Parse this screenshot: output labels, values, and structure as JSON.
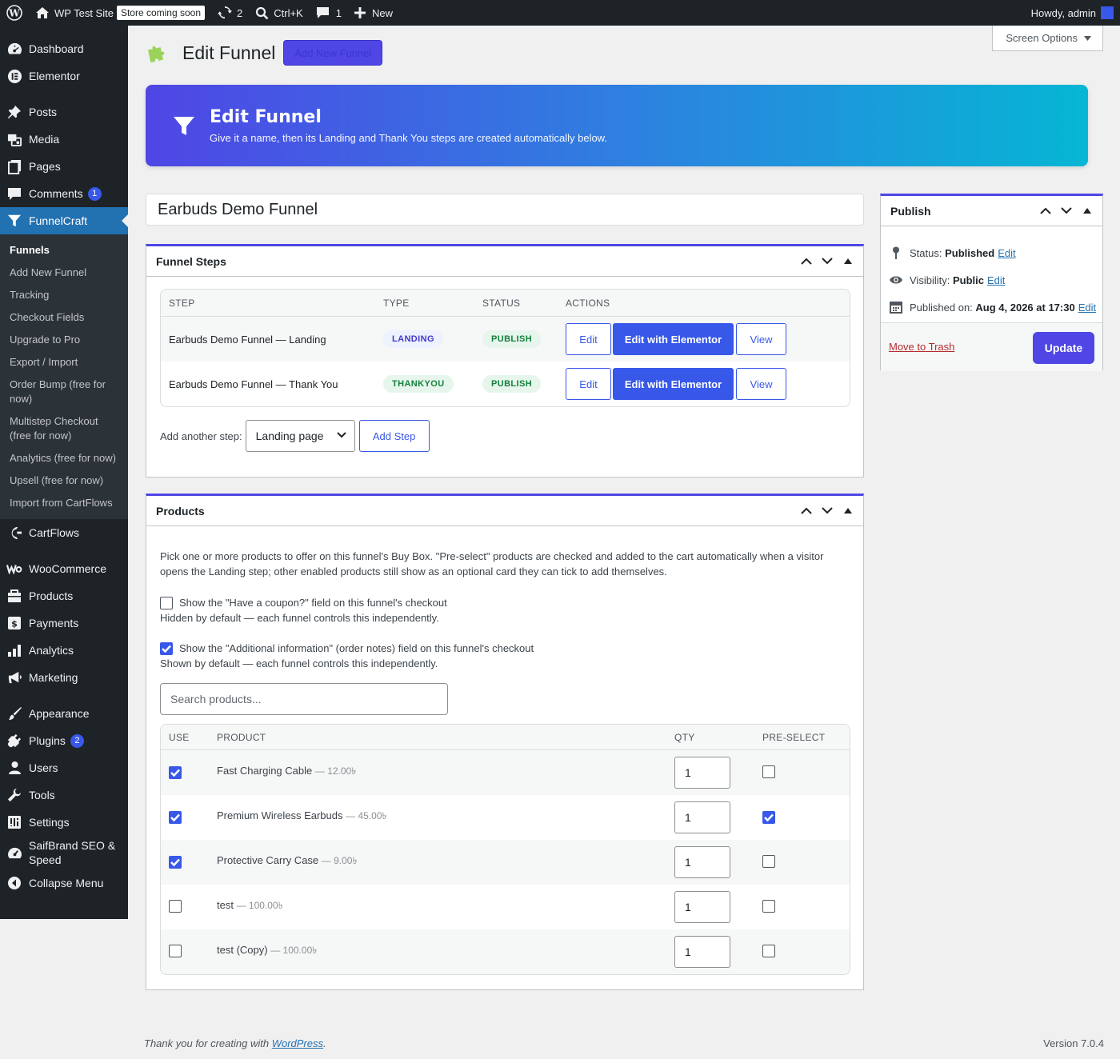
{
  "adminbar": {
    "site_name": "WP Test Site",
    "store_badge": "Store coming soon",
    "updates_count": "2",
    "search_shortcut": "Ctrl+K",
    "comments_count": "1",
    "new_label": "New",
    "howdy": "Howdy, admin"
  },
  "sidebar": {
    "items": [
      {
        "label": "Dashboard",
        "icon": "dashboard-icon"
      },
      {
        "label": "Elementor",
        "icon": "elementor-icon"
      },
      {
        "label": "Posts",
        "icon": "pin-icon"
      },
      {
        "label": "Media",
        "icon": "media-icon"
      },
      {
        "label": "Pages",
        "icon": "pages-icon"
      },
      {
        "label": "Comments",
        "icon": "comment-icon",
        "badge": "1"
      },
      {
        "label": "FunnelCraft",
        "icon": "funnel-icon"
      },
      {
        "label": "CartFlows",
        "icon": "cartflows-icon"
      },
      {
        "label": "WooCommerce",
        "icon": "woo-icon"
      },
      {
        "label": "Products",
        "icon": "products-icon"
      },
      {
        "label": "Payments",
        "icon": "payments-icon"
      },
      {
        "label": "Analytics",
        "icon": "analytics-icon"
      },
      {
        "label": "Marketing",
        "icon": "megaphone-icon"
      },
      {
        "label": "Appearance",
        "icon": "brush-icon"
      },
      {
        "label": "Plugins",
        "icon": "plugin-icon",
        "badge": "2"
      },
      {
        "label": "Users",
        "icon": "user-icon"
      },
      {
        "label": "Tools",
        "icon": "wrench-icon"
      },
      {
        "label": "Settings",
        "icon": "settings-icon"
      },
      {
        "label": "SaifBrand SEO & Speed",
        "icon": "gauge-icon"
      },
      {
        "label": "Collapse Menu",
        "icon": "collapse-icon"
      }
    ],
    "submenu": [
      "Funnels",
      "Add New Funnel",
      "Tracking",
      "Checkout Fields",
      "Upgrade to Pro",
      "Export / Import",
      "Order Bump (free for now)",
      "Multistep Checkout (free for now)",
      "Analytics (free for now)",
      "Upsell (free for now)",
      "Import from CartFlows"
    ]
  },
  "header": {
    "screen_options": "Screen Options",
    "page_title": "Edit Funnel",
    "add_new_label": "Add New Funnel"
  },
  "hero": {
    "title": "Edit Funnel",
    "subtitle": "Give it a name, then its Landing and Thank You steps are created automatically below."
  },
  "funnel_title": "Earbuds Demo Funnel",
  "steps_box": {
    "title": "Funnel Steps",
    "columns": [
      "STEP",
      "TYPE",
      "STATUS",
      "ACTIONS"
    ],
    "rows": [
      {
        "step": "Earbuds Demo Funnel — Landing",
        "type": "LANDING",
        "status": "PUBLISH"
      },
      {
        "step": "Earbuds Demo Funnel — Thank You",
        "type": "THANKYOU",
        "status": "PUBLISH"
      }
    ],
    "edit_label": "Edit",
    "elementor_label": "Edit with Elementor",
    "view_label": "View",
    "add_another_label": "Add another step:",
    "select_value": "Landing page",
    "add_step_label": "Add Step"
  },
  "products_box": {
    "title": "Products",
    "description": "Pick one or more products to offer on this funnel's Buy Box. \"Pre-select\" products are checked and added to the cart automatically when a visitor opens the Landing step; other enabled products still show as an optional card they can tick to add themselves.",
    "coupon_label": "Show the \"Have a coupon?\" field on this funnel's checkout",
    "coupon_help": "Hidden by default — each funnel controls this independently.",
    "coupon_checked": false,
    "notes_label": "Show the \"Additional information\" (order notes) field on this funnel's checkout",
    "notes_help": "Shown by default — each funnel controls this independently.",
    "notes_checked": true,
    "search_placeholder": "Search products...",
    "columns": [
      "USE",
      "PRODUCT",
      "QTY",
      "PRE-SELECT"
    ],
    "rows": [
      {
        "name": "Fast Charging Cable",
        "price": "— 12.00৳",
        "use": true,
        "qty": "1",
        "preselect": false
      },
      {
        "name": "Premium Wireless Earbuds",
        "price": "— 45.00৳",
        "use": true,
        "qty": "1",
        "preselect": true
      },
      {
        "name": "Protective Carry Case",
        "price": "— 9.00৳",
        "use": true,
        "qty": "1",
        "preselect": false
      },
      {
        "name": "test",
        "price": "— 100.00৳",
        "use": false,
        "qty": "1",
        "preselect": false
      },
      {
        "name": "test (Copy)",
        "price": "— 100.00৳",
        "use": false,
        "qty": "1",
        "preselect": false
      }
    ]
  },
  "publish": {
    "title": "Publish",
    "status_label": "Status:",
    "status_value": "Published",
    "visibility_label": "Visibility:",
    "visibility_value": "Public",
    "published_label": "Published on:",
    "published_value": "Aug 4, 2026 at 17:30",
    "edit_link": "Edit",
    "trash_label": "Move to Trash",
    "update_label": "Update"
  },
  "footer": {
    "thanks_prefix": "Thank you for creating with",
    "wordpress_link": "WordPress",
    "thanks_suffix": ".",
    "version": "Version 7.0.4"
  },
  "colors": {
    "accent": "#4f46e5",
    "primary_button": "#3858e9",
    "adminbar_bg": "#1d2327",
    "active_menu": "#2271b1"
  }
}
